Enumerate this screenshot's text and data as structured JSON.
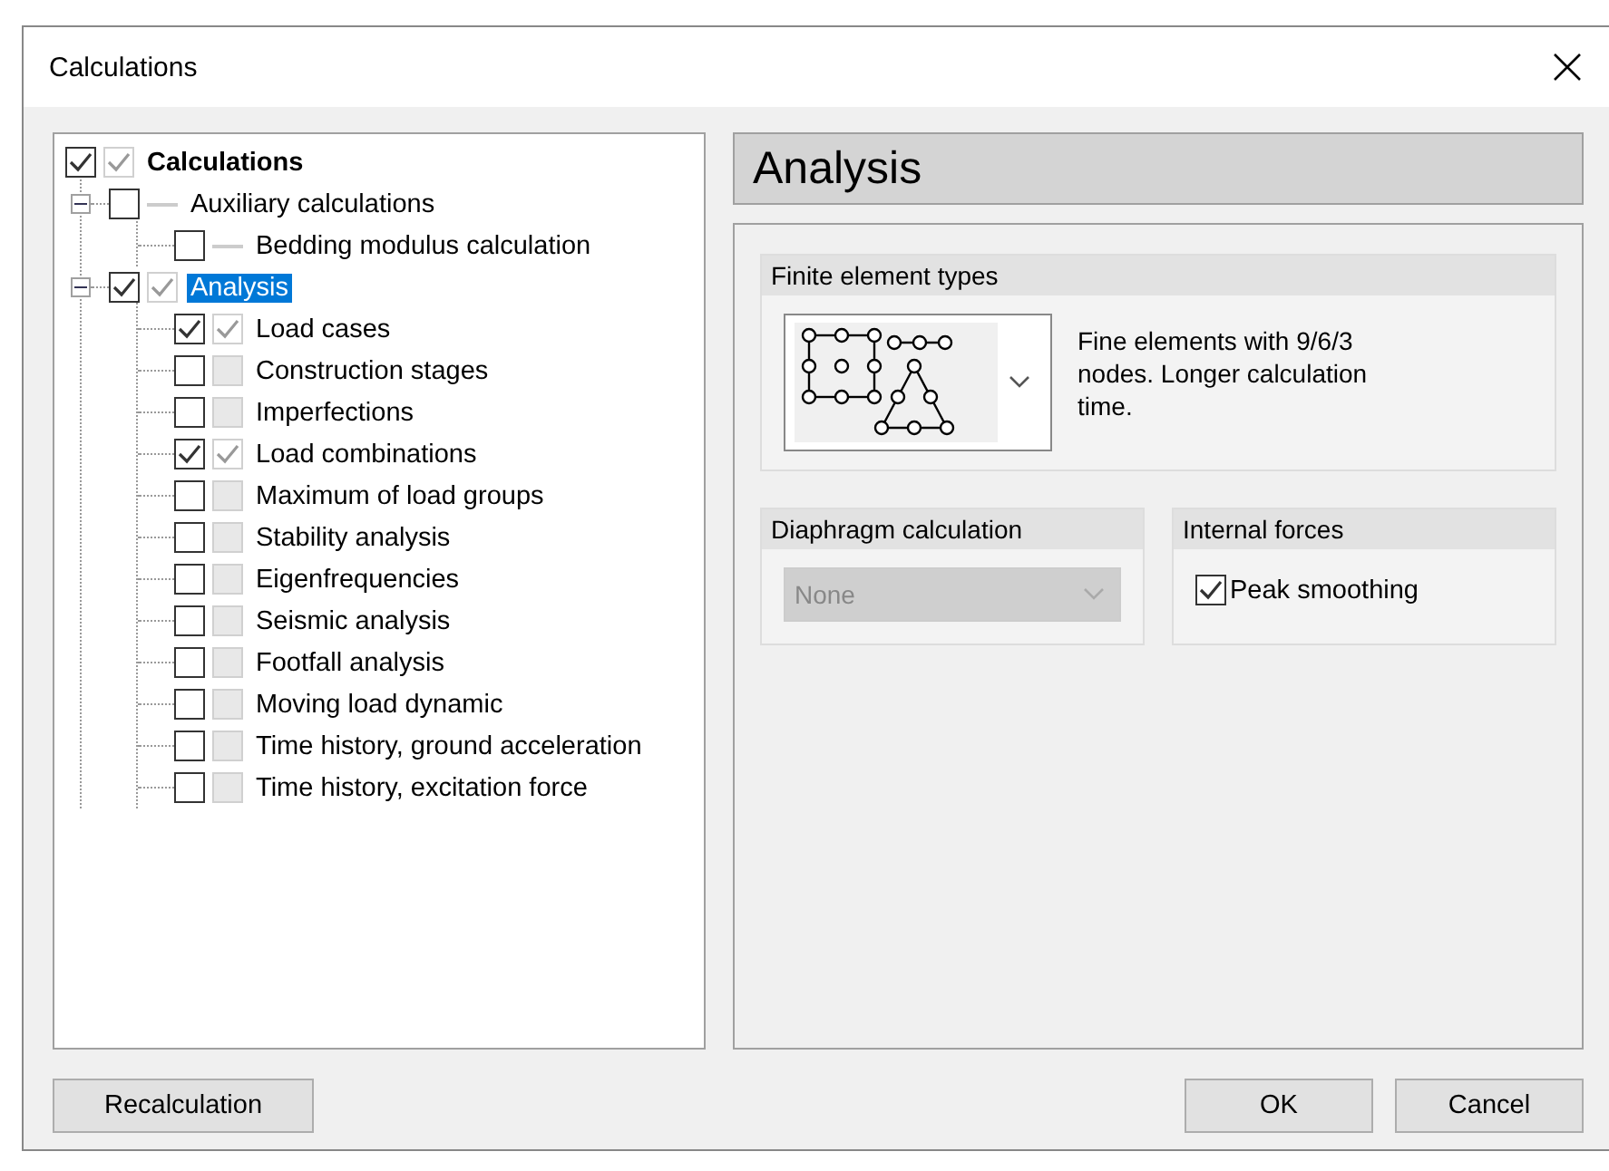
{
  "window": {
    "title": "Calculations"
  },
  "tree": [
    {
      "label": "Calculations",
      "bold": true,
      "checked": true,
      "result_available": true,
      "result_checked": true,
      "children": [
        {
          "label": "Auxiliary calculations",
          "checked": false,
          "result_available": false,
          "expanded": true,
          "selected": false,
          "children": [
            {
              "label": "Bedding modulus calculation",
              "checked": false,
              "result_available": false,
              "selected": false
            }
          ]
        },
        {
          "label": "Analysis",
          "checked": true,
          "result_available": true,
          "result_checked": true,
          "expanded": true,
          "selected": true,
          "children": [
            {
              "label": "Load cases",
              "checked": true,
              "result_available": true,
              "result_checked": true,
              "selected": false
            },
            {
              "label": "Construction stages",
              "checked": false,
              "result_available": true,
              "result_checked": false,
              "selected": false
            },
            {
              "label": "Imperfections",
              "checked": false,
              "result_available": true,
              "result_checked": false,
              "selected": false
            },
            {
              "label": "Load combinations",
              "checked": true,
              "result_available": true,
              "result_checked": true,
              "selected": false
            },
            {
              "label": "Maximum of load groups",
              "checked": false,
              "result_available": true,
              "result_checked": false,
              "selected": false
            },
            {
              "label": "Stability analysis",
              "checked": false,
              "result_available": true,
              "result_checked": false,
              "selected": false
            },
            {
              "label": "Eigenfrequencies",
              "checked": false,
              "result_available": true,
              "result_checked": false,
              "selected": false
            },
            {
              "label": "Seismic analysis",
              "checked": false,
              "result_available": true,
              "result_checked": false,
              "selected": false
            },
            {
              "label": "Footfall analysis",
              "checked": false,
              "result_available": true,
              "result_checked": false,
              "selected": false
            },
            {
              "label": "Moving load dynamic",
              "checked": false,
              "result_available": true,
              "result_checked": false,
              "selected": false
            },
            {
              "label": "Time history, ground acceleration",
              "checked": false,
              "result_available": true,
              "result_checked": false,
              "selected": false
            },
            {
              "label": "Time history, excitation force",
              "checked": false,
              "result_available": true,
              "result_checked": false,
              "selected": false
            }
          ]
        }
      ]
    }
  ],
  "panel": {
    "title": "Analysis",
    "finite_element_types": {
      "title": "Finite element types",
      "description": "Fine elements with 9/6/3 nodes. Longer calculation time."
    },
    "diaphragm_calculation": {
      "title": "Diaphragm calculation",
      "value": "None",
      "disabled": true
    },
    "internal_forces": {
      "title": "Internal forces",
      "option": {
        "label": "Peak smoothing",
        "checked": true
      }
    }
  },
  "buttons": {
    "left": "Recalculation",
    "ok": "OK",
    "cancel": "Cancel"
  }
}
